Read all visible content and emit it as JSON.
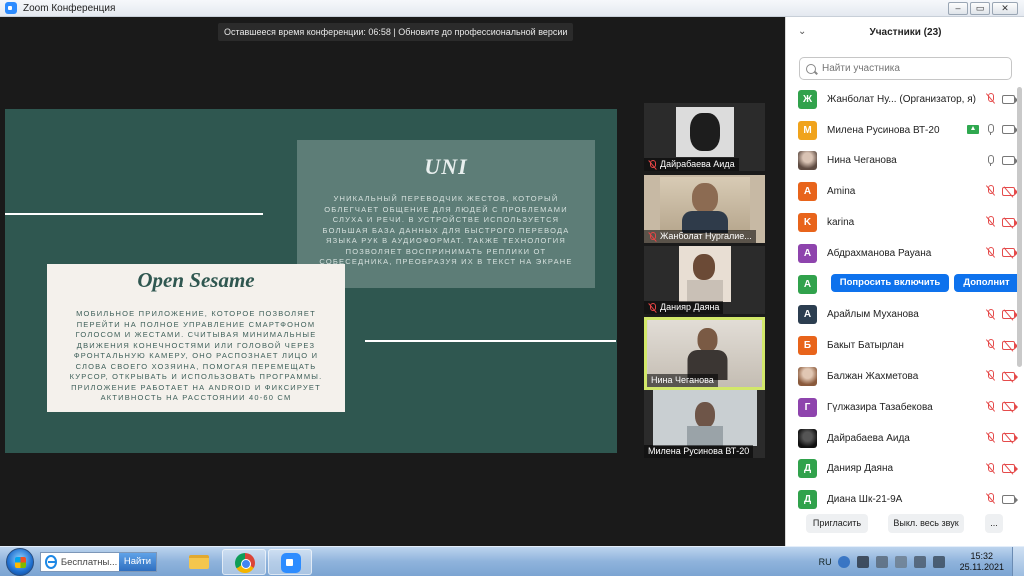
{
  "window": {
    "title": "Zoom Конференция",
    "buttons": [
      "–",
      "▭",
      "✕"
    ]
  },
  "meeting": {
    "timer_text": "Оставшееся время конференции: 06:58 | Обновите до профессиональной версии",
    "slide": {
      "uni": {
        "title": "UNI",
        "text": "Уникальный переводчик жестов, который облегчает общение для людей с проблемами слуха и речи. В устройстве используется большая база данных для быстрого перевода языка рук в аудиоформат. Также технология позволяет воспринимать реплики от собеседника, преобразуя их в текст на экране"
      },
      "open_sesame": {
        "title": "Open Sesame",
        "text": "Мобильное приложение, которое позволяет перейти на полное управление смартфоном голосом и жестами. Считывая минимальные движения конечностями или головой через фронтальную камеру, оно распознает лицо и слова своего хозяина, помогая перемещать курсор, открывать и использовать программы. Приложение работает на Android и фиксирует активность на расстоянии 40-60 см"
      }
    },
    "videos": [
      {
        "name": "Дайрабаева Аида",
        "muted": true
      },
      {
        "name": "Жанболат Нургалие...",
        "muted": true
      },
      {
        "name": "Данияр Даяна",
        "muted": true
      },
      {
        "name": "Нина Чеганова",
        "muted": false,
        "active": true
      },
      {
        "name": "Милена Русинова ВТ-20",
        "muted": false
      }
    ]
  },
  "participants": {
    "title": "Участники (23)",
    "search_placeholder": "Найти участника",
    "ask_unmute_label": "Попросить включить",
    "more_label": "Дополнит",
    "list": [
      {
        "initial": "Ж",
        "color": "#31a24c",
        "name": "Жанболат Ну...  (Организатор, я)",
        "mic": "off",
        "cam": "on"
      },
      {
        "initial": "М",
        "color": "#f0a31c",
        "name": "Милена Русинова ВТ-20",
        "mic": "on",
        "cam": "on",
        "share": true
      },
      {
        "initial": "",
        "color": "#888888",
        "name": "Нина Чеганова",
        "mic": "on",
        "cam": "on",
        "photo": true
      },
      {
        "initial": "A",
        "color": "#e8641b",
        "name": "Amina",
        "mic": "off",
        "cam": "off"
      },
      {
        "initial": "K",
        "color": "#e8641b",
        "name": "karina",
        "mic": "off",
        "cam": "off"
      },
      {
        "initial": "А",
        "color": "#8e44ad",
        "name": "Абдрахманова Рауана",
        "mic": "off",
        "cam": "off"
      },
      {
        "initial": "A",
        "color": "#31a24c",
        "name": "",
        "hover": true
      },
      {
        "initial": "А",
        "color": "#2c3e50",
        "name": "Арайлым Муханова",
        "mic": "off",
        "cam": "off"
      },
      {
        "initial": "Б",
        "color": "#e8641b",
        "name": "Бакыт Батырлан",
        "mic": "off",
        "cam": "off"
      },
      {
        "initial": "",
        "color": "#888888",
        "name": "Балжан Жахметова",
        "mic": "off",
        "cam": "off",
        "photo": true
      },
      {
        "initial": "Г",
        "color": "#8e44ad",
        "name": "Гүлжазира Тазабекова",
        "mic": "off",
        "cam": "off"
      },
      {
        "initial": "",
        "color": "#222222",
        "name": "Дайрабаева Аида",
        "mic": "off",
        "cam": "off",
        "photo": true
      },
      {
        "initial": "Д",
        "color": "#31a24c",
        "name": "Данияр Даяна",
        "mic": "off",
        "cam": "off"
      },
      {
        "initial": "Д",
        "color": "#31a24c",
        "name": "Диана Шк-21-9А",
        "mic": "off",
        "cam": "on"
      }
    ],
    "footer": {
      "invite": "Пригласить",
      "mute_all": "Выкл. весь звук",
      "more": "..."
    }
  },
  "taskbar": {
    "search_value": "Бесплатны...",
    "search_button": "Найти",
    "lang": "RU",
    "time": "15:32",
    "date": "25.11.2021"
  }
}
